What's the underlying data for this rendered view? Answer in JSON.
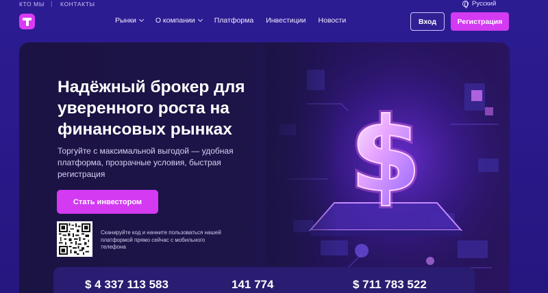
{
  "topbar": {
    "links": [
      "КТО МЫ",
      "КОНТАКТЫ"
    ],
    "separator": "|",
    "language": "Русский"
  },
  "header": {
    "nav": [
      {
        "label": "Рынки",
        "dropdown": true
      },
      {
        "label": "О компании",
        "dropdown": true
      },
      {
        "label": "Платформа",
        "dropdown": false
      },
      {
        "label": "Инвестиции",
        "dropdown": false
      },
      {
        "label": "Новости",
        "dropdown": false
      }
    ],
    "login_label": "Вход",
    "register_label": "Регистрация"
  },
  "hero": {
    "title": "Надёжный брокер для уверенного роста на финансовых рынках",
    "subtitle": "Торгуйте с максимальной выгодой — удобная платформа, прозрачные условия, быстрая регистрация",
    "cta_label": "Стать инвестором",
    "qr_text": "Сканируйте код и начните пользоваться нашей платформой прямо сейчас с мобильного телефона",
    "art_icon": "neon-dollar-sign-icon"
  },
  "stats": [
    "$ 4 337 113 583",
    "141 774",
    "$ 711 783 522"
  ],
  "colors": {
    "accent": "#d33af2",
    "background": "#2a1a8a",
    "hero_bg": "#1b1343"
  }
}
